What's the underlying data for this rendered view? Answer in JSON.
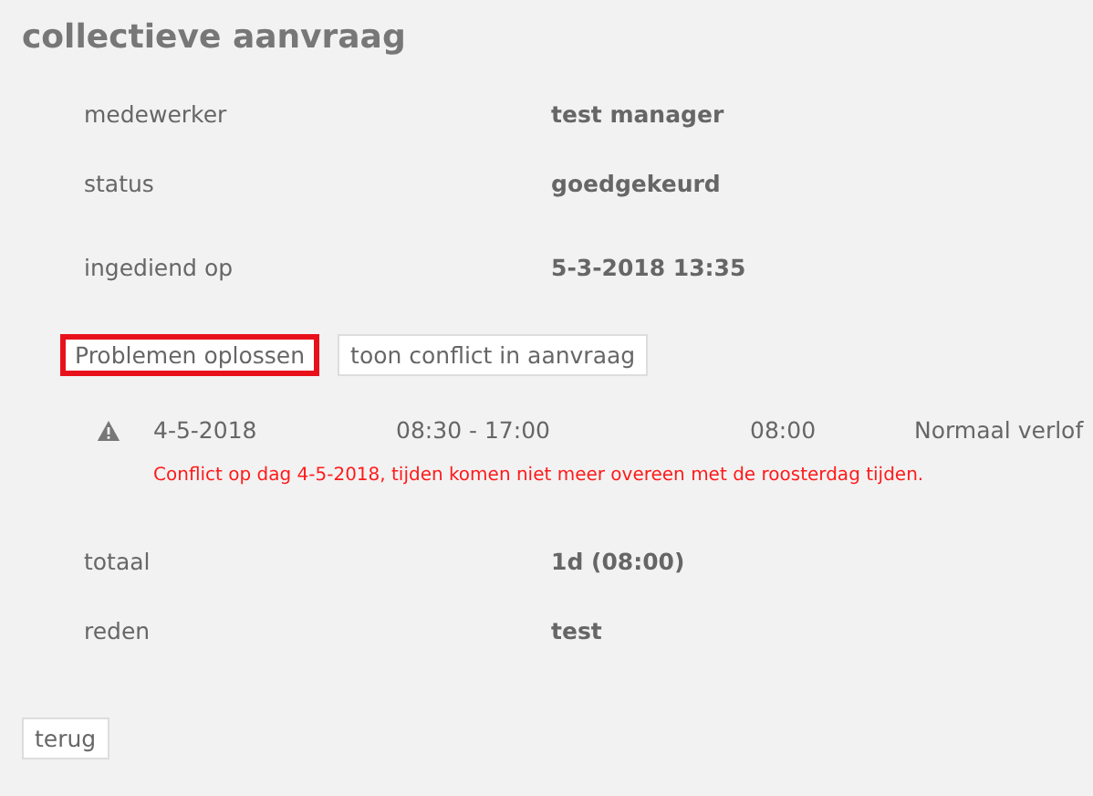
{
  "title": "collectieve aanvraag",
  "details": [
    {
      "label": "medewerker",
      "value": "test manager"
    },
    {
      "label": "status",
      "value": "goedgekeurd"
    },
    {
      "label": "ingediend op",
      "value": "5-3-2018 13:35"
    }
  ],
  "actions": [
    {
      "label": "Problemen oplossen",
      "highlighted": true
    },
    {
      "label": "toon conflict in aanvraag",
      "highlighted": false
    }
  ],
  "conflicts": [
    {
      "warning": true,
      "date": "4-5-2018",
      "time": "08:30 - 17:00",
      "hours": "08:00",
      "type": "Normaal verlof",
      "message": "Conflict op dag 4-5-2018, tijden komen niet meer overeen met de roosterdag tijden."
    }
  ],
  "summary": [
    {
      "label": "totaal",
      "value": "1d (08:00)"
    },
    {
      "label": "reden",
      "value": "test"
    }
  ],
  "back_button": "terug"
}
